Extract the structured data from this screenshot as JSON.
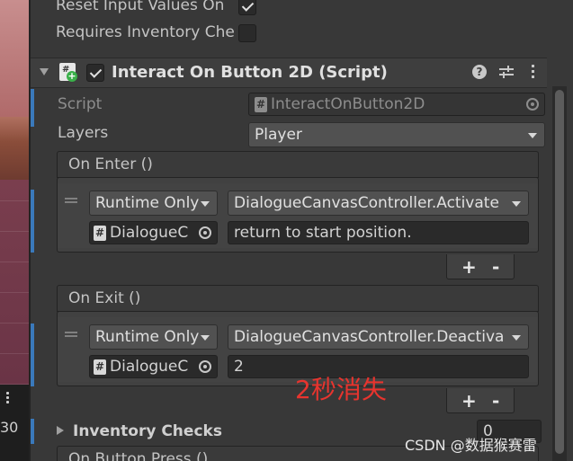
{
  "top_fields": {
    "reset_input_label": "Reset Input Values On",
    "reset_input_checked": true,
    "requires_inventory_label": "Requires Inventory Che",
    "requires_inventory_checked": false
  },
  "component": {
    "title": "Interact On Button 2D (Script)",
    "enabled": true,
    "icon": "script-component-icon",
    "script_label": "Script",
    "script_value": "InteractOnButton2D",
    "layers_label": "Layers",
    "layers_value": "Player"
  },
  "on_enter": {
    "header": "On Enter ()",
    "runtime": "Runtime Only",
    "function": "DialogueCanvasController.Activate",
    "object": "DialogueC",
    "argument": "return to start position.",
    "add_label": "+",
    "remove_label": "-"
  },
  "on_exit": {
    "header": "On Exit ()",
    "runtime": "Runtime Only",
    "function": "DialogueCanvasController.Deactiva",
    "object": "DialogueC",
    "argument": "2",
    "add_label": "+",
    "remove_label": "-"
  },
  "inventory_checks": {
    "label": "Inventory Checks",
    "count": "0"
  },
  "on_button_press": {
    "header": "On Button Press ()"
  },
  "scene": {
    "number": "30"
  },
  "annotation": "2秒消失",
  "watermark": "CSDN @数据猴赛雷",
  "colors": {
    "accent_blue": "#3a79bb",
    "annotation_red": "#e8342e"
  }
}
